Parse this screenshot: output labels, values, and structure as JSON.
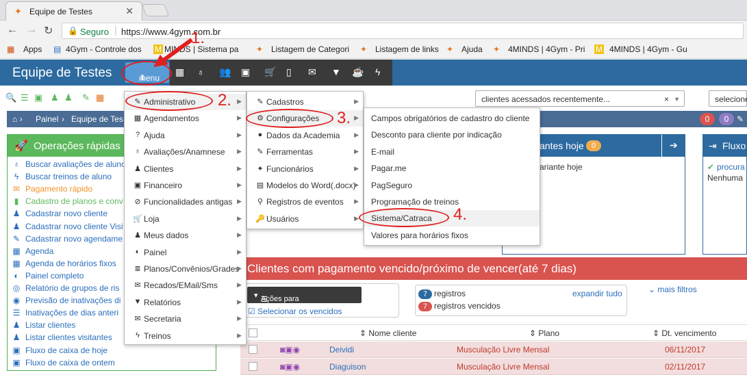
{
  "browser": {
    "tab_title": "Equipe de Testes",
    "address_secure_label": "Seguro",
    "address_url": "https://www.4gym.com.br",
    "bookmarks": [
      "Apps",
      "4Gym - Controle dos",
      "MINDS | Sistema pa",
      "Listagem de Categori",
      "Listagem de links",
      "Ajuda",
      "4MINDS | 4Gym - Pri",
      "4MINDS | 4Gym - Gu"
    ]
  },
  "navbar": {
    "brand": "Equipe de Testes",
    "menu_label": "menu"
  },
  "toolbar": {
    "recent_clients_placeholder": "clientes acessados recentemente...",
    "select_placeholder": "selecione"
  },
  "breadcrumb": {
    "items": [
      "Painel",
      "Equipe de Tes"
    ],
    "badges": [
      "0",
      "0"
    ]
  },
  "quick_ops": {
    "title": "Operações rápidas",
    "items": [
      {
        "label": "Buscar avaliações de aluno",
        "color": "#2a6ebb"
      },
      {
        "label": "Buscar treinos de aluno",
        "color": "#2a6ebb"
      },
      {
        "label": "Pagamento rápido",
        "color": "#f0932b"
      },
      {
        "label": "Cadastro de planos e conv",
        "color": "#5cb85c"
      },
      {
        "label": "Cadastrar novo cliente",
        "color": "#2a6ebb"
      },
      {
        "label": "Cadastrar novo cliente Visi",
        "color": "#2a6ebb"
      },
      {
        "label": "Cadastrar novo agendame",
        "color": "#2a6ebb"
      },
      {
        "label": "Agenda",
        "color": "#2a6ebb"
      },
      {
        "label": "Agenda de horários fixos",
        "color": "#2a6ebb"
      },
      {
        "label": "Painel completo",
        "color": "#2a6ebb"
      },
      {
        "label": "Relatório de grupos de ris",
        "color": "#2a6ebb"
      },
      {
        "label": "Previsão de inativações di",
        "color": "#2a6ebb"
      },
      {
        "label": "Inativações de dias anteri",
        "color": "#2a6ebb"
      },
      {
        "label": "Listar clientes",
        "color": "#2a6ebb"
      },
      {
        "label": "Listar clientes visitantes",
        "color": "#2a6ebb"
      },
      {
        "label": "Fluxo de caixa de hoje",
        "color": "#2a6ebb"
      },
      {
        "label": "Fluxo de caixa de ontem",
        "color": "#2a6ebb"
      }
    ]
  },
  "panels": {
    "visitantes_title": "antes hoje",
    "visitantes_badge": "0",
    "visitantes_text": "ariante hoje",
    "fluxo_title": "Fluxo",
    "fluxo_link": "procura",
    "fluxo_text": "Nenhuma"
  },
  "overdue": {
    "title": "Clientes com pagamento vencido/próximo de vencer(até 7 dias)",
    "actions_button": "Ações para selecionados",
    "select_overdue": "Selecionar os vencidos",
    "registros_count": "7",
    "registros_label": "registros",
    "vencidos_count": "7",
    "vencidos_label": "registros vencidos",
    "expand_all": "expandir tudo",
    "more_filters": "mais filtros",
    "columns": [
      "Nome cliente",
      "Plano",
      "Dt. vencimento"
    ],
    "rows": [
      {
        "name": "Deividi",
        "plan": "Musculação Livre Mensal",
        "date": "06/11/2017"
      },
      {
        "name": "Diaguison",
        "plan": "Musculação Livre Mensal",
        "date": "02/11/2017"
      }
    ]
  },
  "menu_main": {
    "items": [
      "Administrativo",
      "Agendamentos",
      "Ajuda",
      "Avaliações/Anamnese",
      "Clientes",
      "Financeiro",
      "Funcionalidades antigas",
      "Loja",
      "Meus dados",
      "Painel",
      "Planos/Convênios/Grades",
      "Recados/EMail/Sms",
      "Relatórios",
      "Secretaria",
      "Treinos"
    ]
  },
  "menu_admin": {
    "items": [
      "Cadastros",
      "Configurações",
      "Dados da Academia",
      "Ferramentas",
      "Funcionários",
      "Modelos do Word(.docx)",
      "Registros de eventos",
      "Usuários"
    ]
  },
  "menu_config": {
    "items": [
      "Campos obrigatórios de cadastro do cliente",
      "Desconto para cliente por indicação",
      "E-mail",
      "Pagar.me",
      "PagSeguro",
      "Programação de treinos",
      "Sistema/Catraca",
      "Valores para horários fixos"
    ]
  },
  "annotations": [
    "1.",
    "2.",
    "3.",
    "4."
  ],
  "colors": {
    "navbar": "#2c6aa0",
    "menu_button": "#5b9bd5",
    "ops_green": "#5cb85c",
    "danger": "#d9534f",
    "annotation_red": "#e02020"
  }
}
